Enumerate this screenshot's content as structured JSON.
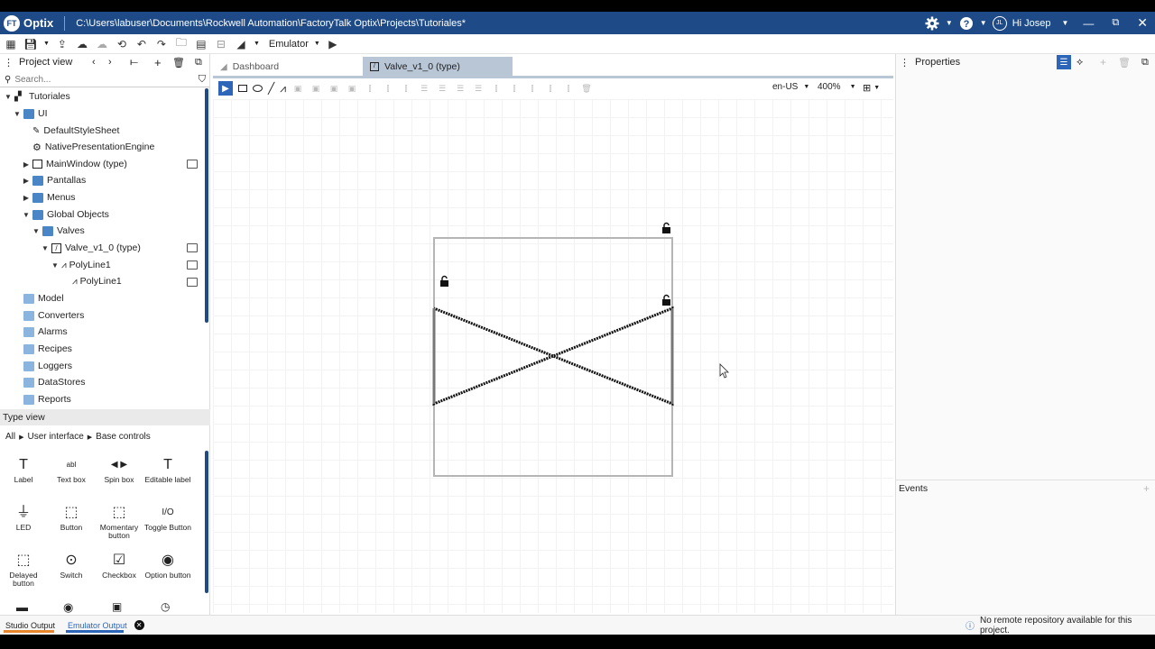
{
  "titlebar": {
    "app_name": "Optix",
    "logo_text": "FT",
    "path": "C:\\Users\\labuser\\Documents\\Rockwell Automation\\FactoryTalk Optix\\Projects\\Tutoriales*",
    "avatar_initials": "JL",
    "user_greeting": "Hi Josep"
  },
  "toolbar": {
    "emulator_label": "Emulator"
  },
  "project_view": {
    "title": "Project view",
    "search_placeholder": "Search...",
    "tree": [
      {
        "label": "Tutoriales"
      },
      {
        "label": "UI"
      },
      {
        "label": "DefaultStyleSheet"
      },
      {
        "label": "NativePresentationEngine"
      },
      {
        "label": "MainWindow (type)"
      },
      {
        "label": "Pantallas"
      },
      {
        "label": "Menus"
      },
      {
        "label": "Global Objects"
      },
      {
        "label": "Valves"
      },
      {
        "label": "Valve_v1_0 (type)"
      },
      {
        "label": "PolyLine1"
      },
      {
        "label": "PolyLine1"
      },
      {
        "label": "Model"
      },
      {
        "label": "Converters"
      },
      {
        "label": "Alarms"
      },
      {
        "label": "Recipes"
      },
      {
        "label": "Loggers"
      },
      {
        "label": "DataStores"
      },
      {
        "label": "Reports"
      }
    ]
  },
  "type_view": {
    "title": "Type view",
    "breadcrumb": [
      "All",
      "User interface",
      "Base controls"
    ],
    "controls": [
      {
        "label": "Label",
        "glyph": "T"
      },
      {
        "label": "Text box",
        "glyph": "abl"
      },
      {
        "label": "Spin box",
        "glyph": "◀ ▶"
      },
      {
        "label": "Editable label",
        "glyph": "T"
      },
      {
        "label": "LED",
        "glyph": "⏚"
      },
      {
        "label": "Button",
        "glyph": "⬚"
      },
      {
        "label": "Momentary button",
        "glyph": "⬚"
      },
      {
        "label": "Toggle Button",
        "glyph": "I/O"
      },
      {
        "label": "Delayed button",
        "glyph": "⬚"
      },
      {
        "label": "Switch",
        "glyph": "⊙"
      },
      {
        "label": "Checkbox",
        "glyph": "☑"
      },
      {
        "label": "Option button",
        "glyph": "◉"
      }
    ]
  },
  "editor": {
    "tabs": [
      {
        "label": "Dashboard"
      },
      {
        "label": "Valve_v1_0 (type)"
      }
    ],
    "locale": "en-US",
    "zoom": "400%"
  },
  "properties": {
    "title": "Properties",
    "events_title": "Events"
  },
  "statusbar": {
    "studio_output": "Studio Output",
    "emulator_output": "Emulator Output",
    "message": "No remote repository available for this project."
  },
  "colors": {
    "titlebar": "#1e4b87",
    "accent": "#2d66b8",
    "studio_output_underline": "#e8862e",
    "emulator_output_underline": "#2d66b8"
  }
}
